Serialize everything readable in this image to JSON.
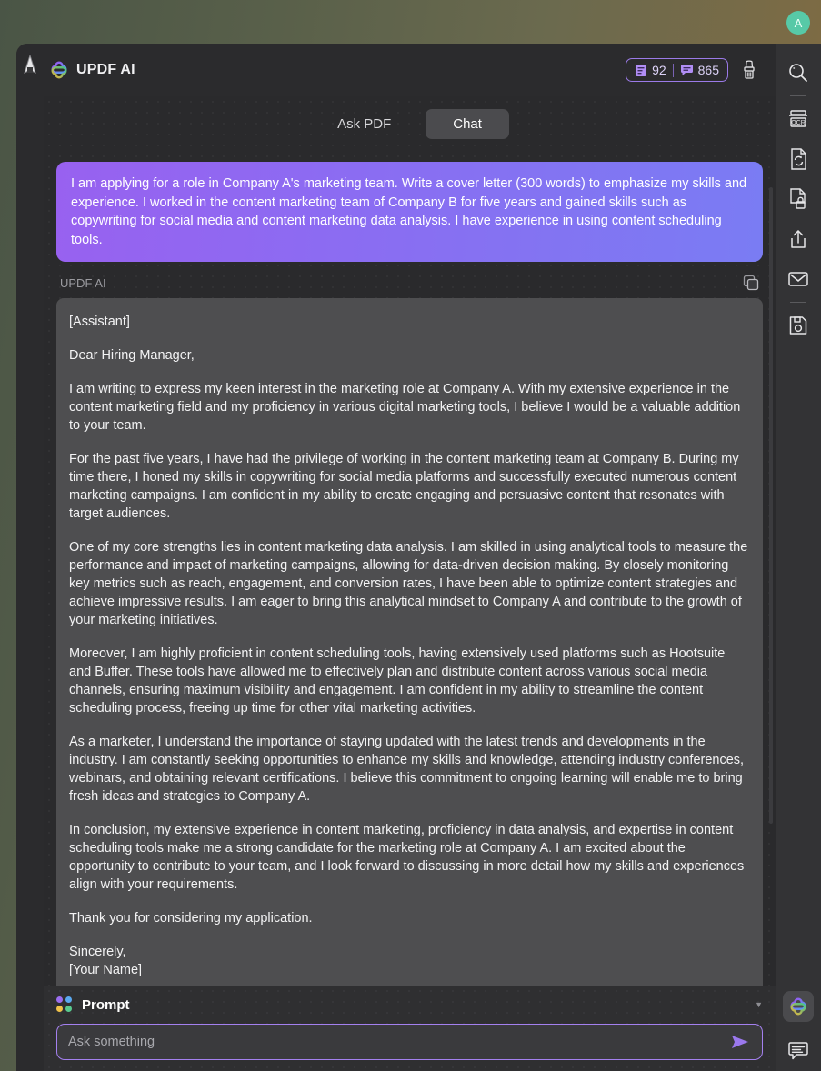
{
  "desktop": {
    "avatar_initial": "A",
    "avatar_color": "#57c9a7"
  },
  "left_rail": {
    "cursor_icon": "pen-cursor-icon"
  },
  "header": {
    "brand_title": "UPDF AI",
    "logo_icon": "updf-clover-logo-icon",
    "credits": {
      "doc_icon": "document-credits-icon",
      "doc_count": "92",
      "chat_icon": "chat-credits-icon",
      "chat_count": "865",
      "border_color": "#9b7ae8",
      "text_color": "#cbb6f7"
    },
    "brush_icon": "paintbrush-icon"
  },
  "tabs": [
    {
      "label": "Ask PDF",
      "active": false,
      "name": "tab-ask-pdf"
    },
    {
      "label": "Chat",
      "active": true,
      "name": "tab-chat"
    }
  ],
  "conversation": {
    "user_message": "I am applying for a role in Company A's marketing team. Write a cover letter (300 words) to emphasize my skills and experience. I worked in the content marketing team of Company B for five years and gained skills such as copywriting for social media and content marketing data analysis. I have experience in using content scheduling tools.",
    "assistant_label": "UPDF AI",
    "copy_icon": "copy-icon",
    "assistant_paragraphs": [
      "[Assistant]",
      "Dear Hiring Manager,",
      "I am writing to express my keen interest in the marketing role at Company A. With my extensive experience in the content marketing field and my proficiency in various digital marketing tools, I believe I would be a valuable addition to your team.",
      "For the past five years, I have had the privilege of working in the content marketing team at Company B. During my time there, I honed my skills in copywriting for social media platforms and successfully executed numerous content marketing campaigns. I am confident in my ability to create engaging and persuasive content that resonates with target audiences.",
      "One of my core strengths lies in content marketing data analysis. I am skilled in using analytical tools to measure the performance and impact of marketing campaigns, allowing for data-driven decision making. By closely monitoring key metrics such as reach, engagement, and conversion rates, I have been able to optimize content strategies and achieve impressive results. I am eager to bring this analytical mindset to Company A and contribute to the growth of your marketing initiatives.",
      "Moreover, I am highly proficient in content scheduling tools, having extensively used platforms such as Hootsuite and Buffer. These tools have allowed me to effectively plan and distribute content across various social media channels, ensuring maximum visibility and engagement. I am confident in my ability to streamline the content scheduling process, freeing up time for other vital marketing activities.",
      "As a marketer, I understand the importance of staying updated with the latest trends and developments in the industry. I am constantly seeking opportunities to enhance my skills and knowledge, attending industry conferences, webinars, and obtaining relevant certifications. I believe this commitment to ongoing learning will enable me to bring fresh ideas and strategies to Company A.",
      "In conclusion, my extensive experience in content marketing, proficiency in data analysis, and expertise in content scheduling tools make me a strong candidate for the marketing role at Company A. I am excited about the opportunity to contribute to your team, and I look forward to discussing in more detail how my skills and experiences align with your requirements.",
      "Thank you for considering my application."
    ],
    "signature_line_1": "Sincerely,",
    "signature_line_2": "[Your Name]"
  },
  "prompt": {
    "label": "Prompt",
    "dots_icon": "four-dot-grid-icon",
    "dot_colors": [
      "#9b6ef0",
      "#5aa9f0",
      "#f0c24a",
      "#58c98e"
    ],
    "caret_icon": "chevron-down-icon",
    "input_placeholder": "Ask something",
    "input_value": "",
    "send_icon": "send-arrow-icon",
    "accent_color": "#a480ef"
  },
  "right_rail": {
    "items": [
      {
        "name": "search-icon",
        "label": "Search"
      },
      {
        "name": "separator-1",
        "label": ""
      },
      {
        "name": "ocr-icon",
        "label": "OCR"
      },
      {
        "name": "convert-document-icon",
        "label": "Convert"
      },
      {
        "name": "protect-document-icon",
        "label": "Protect"
      },
      {
        "name": "share-export-icon",
        "label": "Share"
      },
      {
        "name": "email-icon",
        "label": "Email"
      },
      {
        "name": "separator-2",
        "label": ""
      },
      {
        "name": "save-disk-icon",
        "label": "Save"
      }
    ],
    "bottom": [
      {
        "name": "updf-ai-button-icon",
        "label": "UPDF AI"
      },
      {
        "name": "comment-icon",
        "label": "Comment"
      }
    ]
  }
}
